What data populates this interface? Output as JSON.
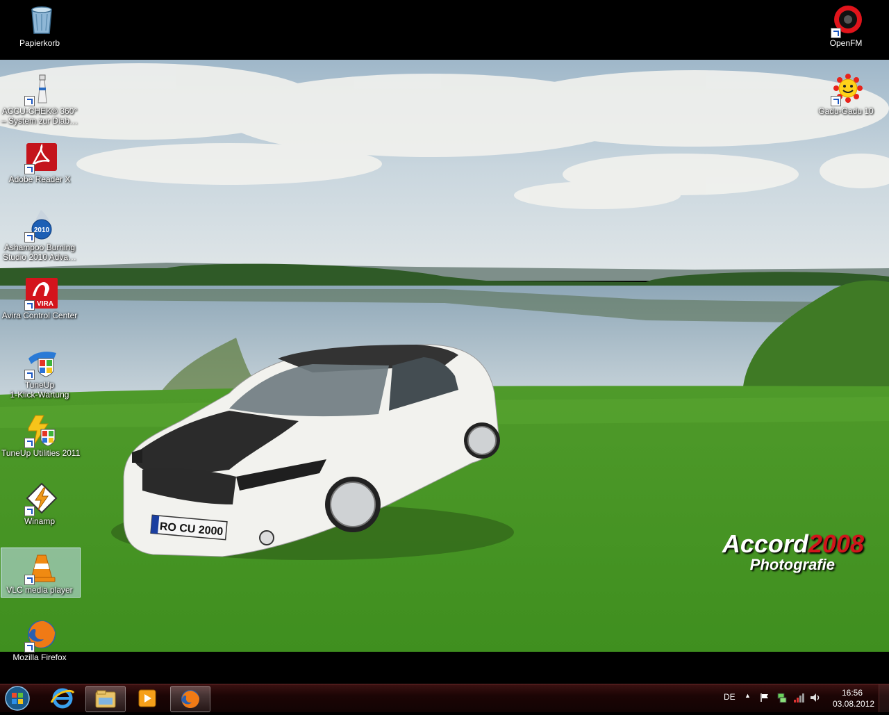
{
  "desktop": {
    "icons": [
      {
        "label": "Papierkorb",
        "icon": "recycle-bin-icon"
      },
      {
        "label": "OpenFM",
        "icon": "openfm-icon"
      },
      {
        "label": "ACCU-CHEK® 360° – System zur Diab…",
        "icon": "lighthouse-icon"
      },
      {
        "label": "Gadu-Gadu 10",
        "icon": "gadu-gadu-sun-icon"
      },
      {
        "label": "Adobe Reader X",
        "icon": "adobe-reader-icon"
      },
      {
        "label": "Ashampoo Burning Studio 2010 Adva…",
        "icon": "ashampoo-flame-disc-icon"
      },
      {
        "label": "Avira Control Center",
        "icon": "avira-umbrella-icon"
      },
      {
        "label": "TuneUp 1-Klick-Wartung",
        "icon": "tuneup-shield-icon"
      },
      {
        "label": "TuneUp Utilities 2011",
        "icon": "tuneup-utilities-icon"
      },
      {
        "label": "Winamp",
        "icon": "winamp-bolt-icon"
      },
      {
        "label": "VLC media player",
        "icon": "vlc-cone-icon"
      },
      {
        "label": "Mozilla Firefox",
        "icon": "firefox-icon"
      }
    ],
    "acc_line1": "ACCU-CHEK® 360°",
    "acc_line2": "– System zur Diab…",
    "ash_line1": "Ashampoo Burning",
    "ash_line2": "Studio 2010 Adva…",
    "tune_line1": "TuneUp",
    "tune_line2": "1-Klick-Wartung"
  },
  "wallpaper": {
    "watermark_part1": "Accord",
    "watermark_part2": "2008",
    "watermark_sub": "Photografie",
    "plate": "RO CU 2000"
  },
  "taskbar": {
    "pinned": [
      "start-orb-icon",
      "internet-explorer-icon",
      "file-explorer-icon",
      "media-player-icon",
      "firefox-icon"
    ],
    "tray": {
      "language": "DE",
      "time": "16:56",
      "date": "03.08.2012"
    }
  },
  "colors": {
    "taskbar": "#1c0505",
    "accent_red": "#d0151b"
  }
}
